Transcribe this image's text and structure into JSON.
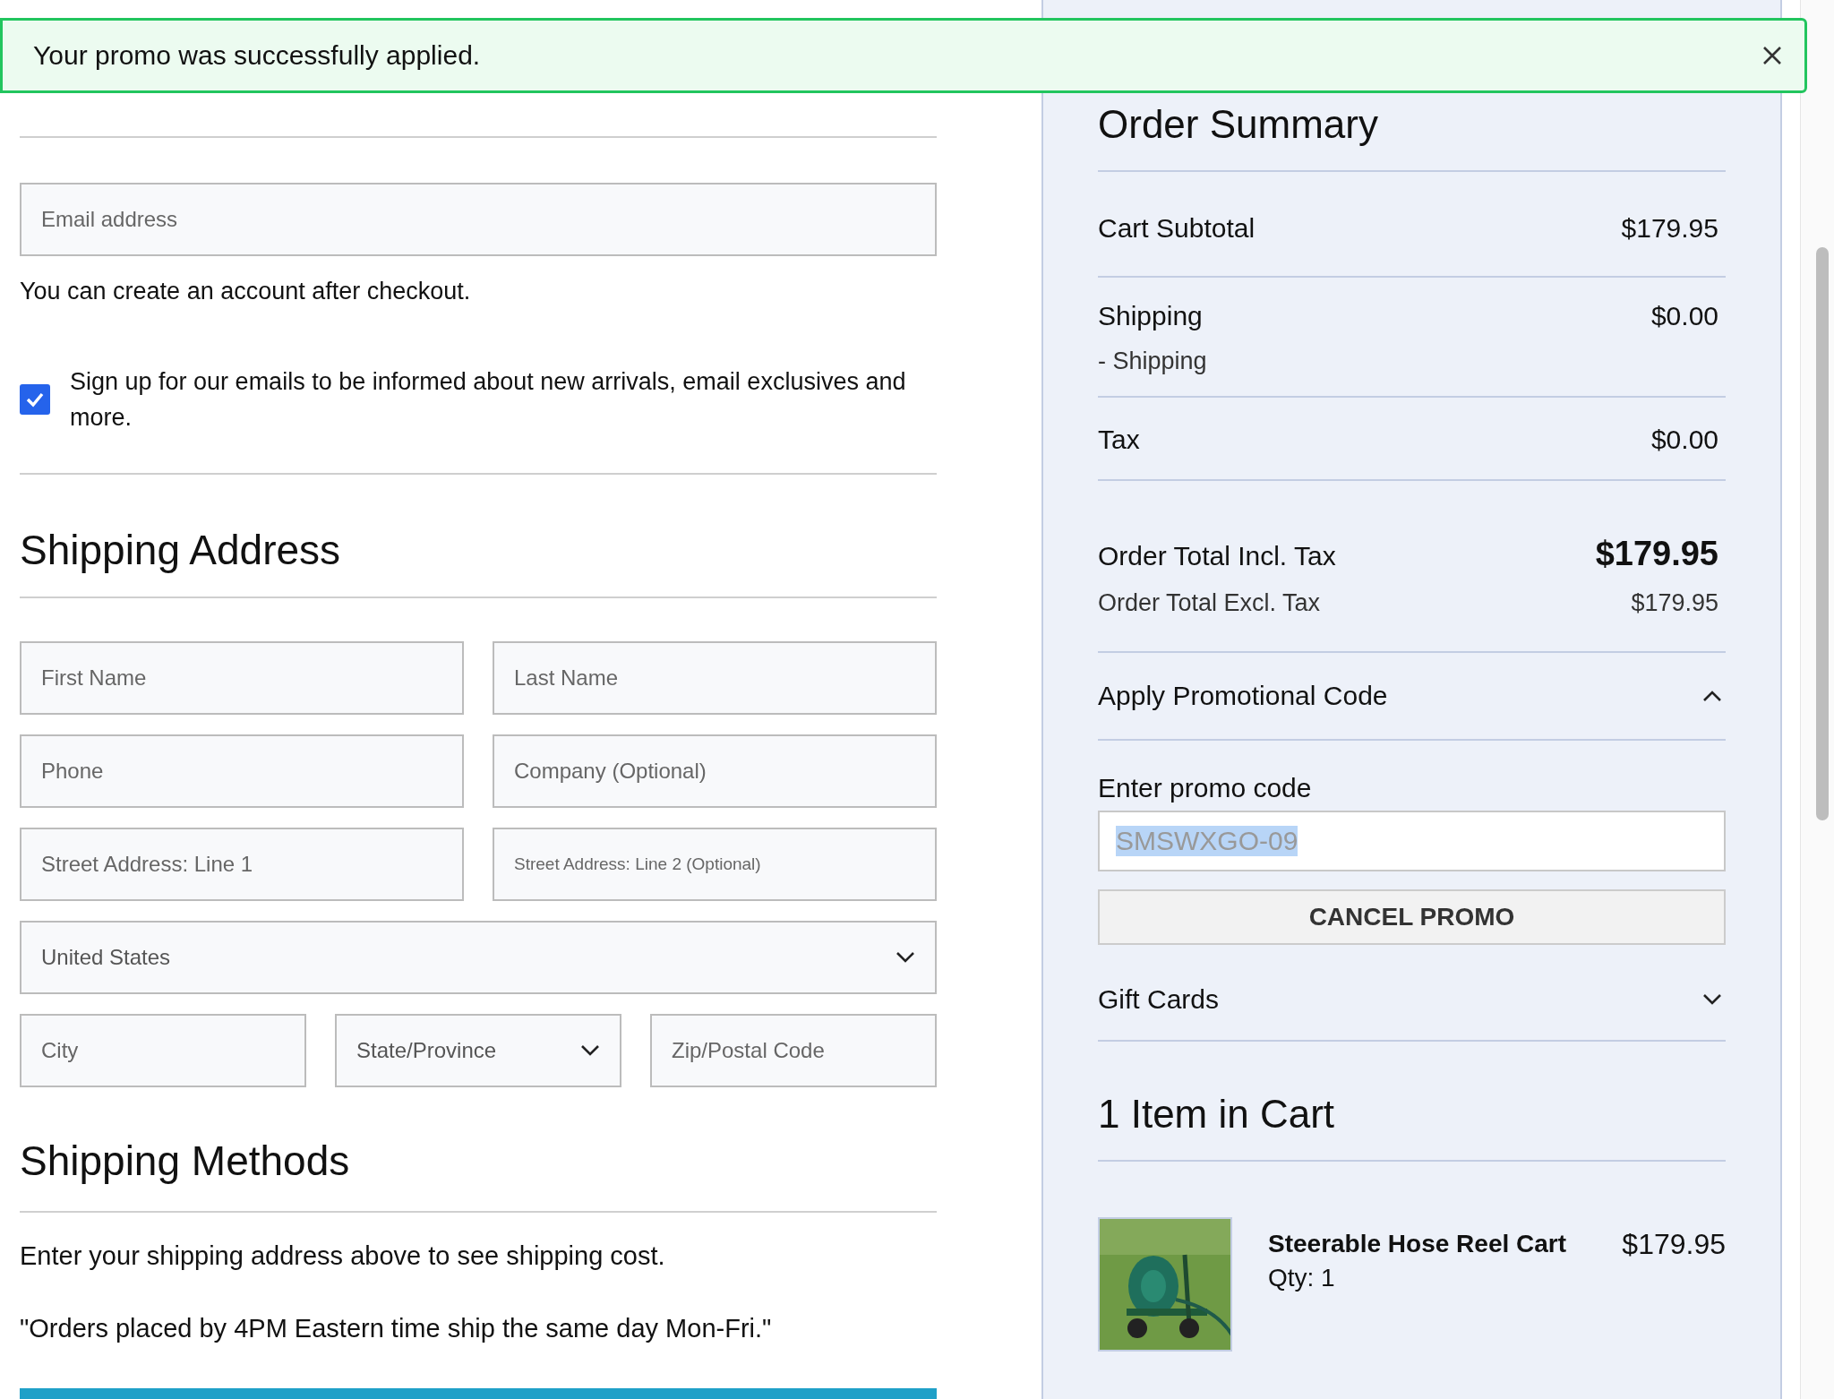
{
  "banner": {
    "message": "Your promo was successfully applied."
  },
  "shipping_information": {
    "email": {
      "placeholder": "Email address"
    },
    "note": "You can create an account after checkout.",
    "newsletter": {
      "label": "Sign up for our emails to be informed about new arrivals, email exclusives and more.",
      "checked": true
    }
  },
  "shipping_address": {
    "title": "Shipping Address",
    "rows": [
      [
        {
          "kind": "input",
          "placeholder": "First Name"
        },
        {
          "kind": "input",
          "placeholder": "Last Name"
        }
      ],
      [
        {
          "kind": "input",
          "placeholder": "Phone"
        },
        {
          "kind": "input",
          "placeholder": "Company (Optional)"
        }
      ],
      [
        {
          "kind": "input",
          "placeholder": "Street Address: Line 1"
        },
        {
          "kind": "input",
          "placeholder": "Street Address: Line 2 (Optional)",
          "small": true
        }
      ],
      [
        {
          "kind": "select",
          "value": "United States"
        }
      ],
      [
        {
          "kind": "input",
          "placeholder": "City"
        },
        {
          "kind": "select",
          "value": "State/Province"
        },
        {
          "kind": "input",
          "placeholder": "Zip/Postal Code"
        }
      ]
    ]
  },
  "shipping_methods": {
    "title": "Shipping Methods",
    "paragraphs": [
      "Enter your shipping address above to see shipping cost.",
      "\"Orders placed by 4PM Eastern time ship the same day Mon-Fri.\""
    ]
  },
  "order_summary": {
    "title": "Order Summary",
    "lines": [
      {
        "label": "Cart Subtotal",
        "value": "$179.95"
      },
      {
        "label": "Shipping",
        "value": "$0.00",
        "sub": "- Shipping"
      },
      {
        "label": "Tax",
        "value": "$0.00"
      }
    ],
    "total": {
      "label": "Order Total Incl. Tax",
      "value": "$179.95",
      "excl_label": "Order Total Excl. Tax",
      "excl_value": "$179.95"
    },
    "promo": {
      "title": "Apply Promotional Code",
      "expanded": true,
      "label": "Enter promo code",
      "value": "SMSWXGO-09",
      "button": "CANCEL PROMO"
    },
    "gift_cards": {
      "title": "Gift Cards",
      "expanded": false
    },
    "cart": {
      "title": "1 Item in Cart",
      "items": [
        {
          "name": "Steerable Hose Reel Cart",
          "qty": "Qty: 1",
          "price": "$179.95"
        }
      ]
    }
  }
}
